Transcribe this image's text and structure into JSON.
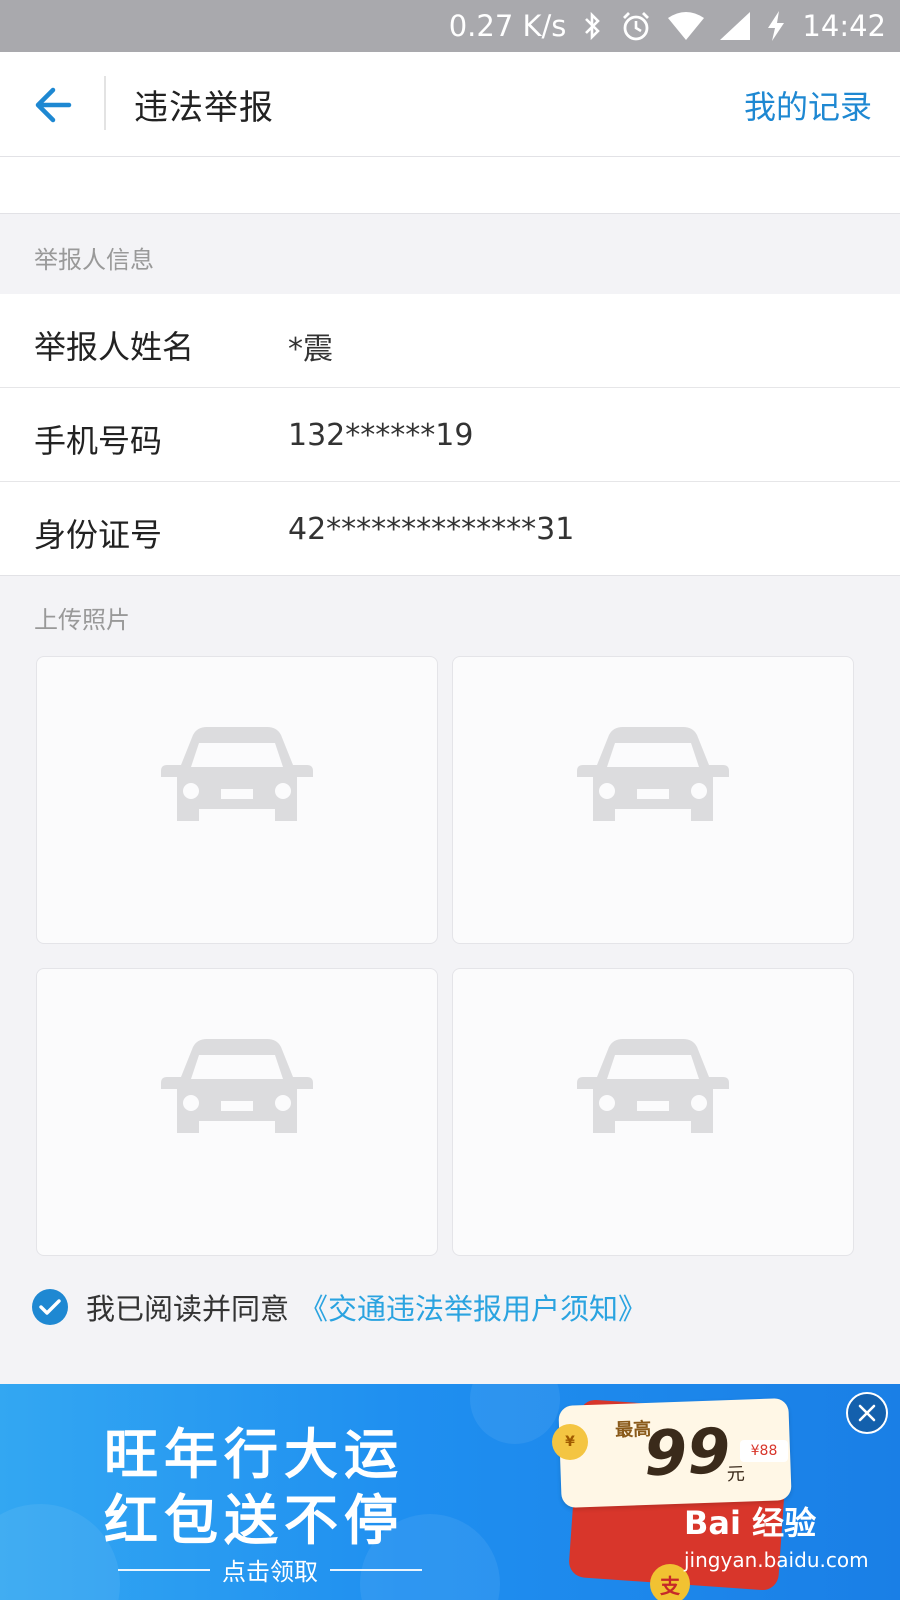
{
  "status_bar": {
    "network_speed": "0.27 K/s",
    "time": "14:42",
    "icons": [
      "bluetooth-icon",
      "alarm-icon",
      "wifi-icon",
      "signal-icon",
      "charging-icon"
    ]
  },
  "header": {
    "title": "违法举报",
    "records_link": "我的记录",
    "back_icon": "back-arrow-icon",
    "accent": "#1e88d2"
  },
  "reporter_section": {
    "label": "举报人信息",
    "rows": [
      {
        "label": "举报人姓名",
        "value": "*震"
      },
      {
        "label": "手机号码",
        "value": "132******19"
      },
      {
        "label": "身份证号",
        "value": "42**************31"
      }
    ]
  },
  "photo_section": {
    "label": "上传照片",
    "slot_icon": "car-placeholder-icon"
  },
  "agreement": {
    "checked": true,
    "text": "我已阅读并同意",
    "link": "《交通违法举报用户须知》"
  },
  "ad_banner": {
    "line1": "旺年行大运",
    "line2": "红包送不停",
    "cta": "点击领取",
    "badge_max": "最高",
    "amount": "99",
    "unit": "元",
    "tag": "¥88",
    "coin_symbol": "¥",
    "pay_symbol": "支",
    "close_icon": "close-icon"
  },
  "watermark": {
    "brand": "Bai 经验",
    "url": "jingyan.baidu.com"
  }
}
